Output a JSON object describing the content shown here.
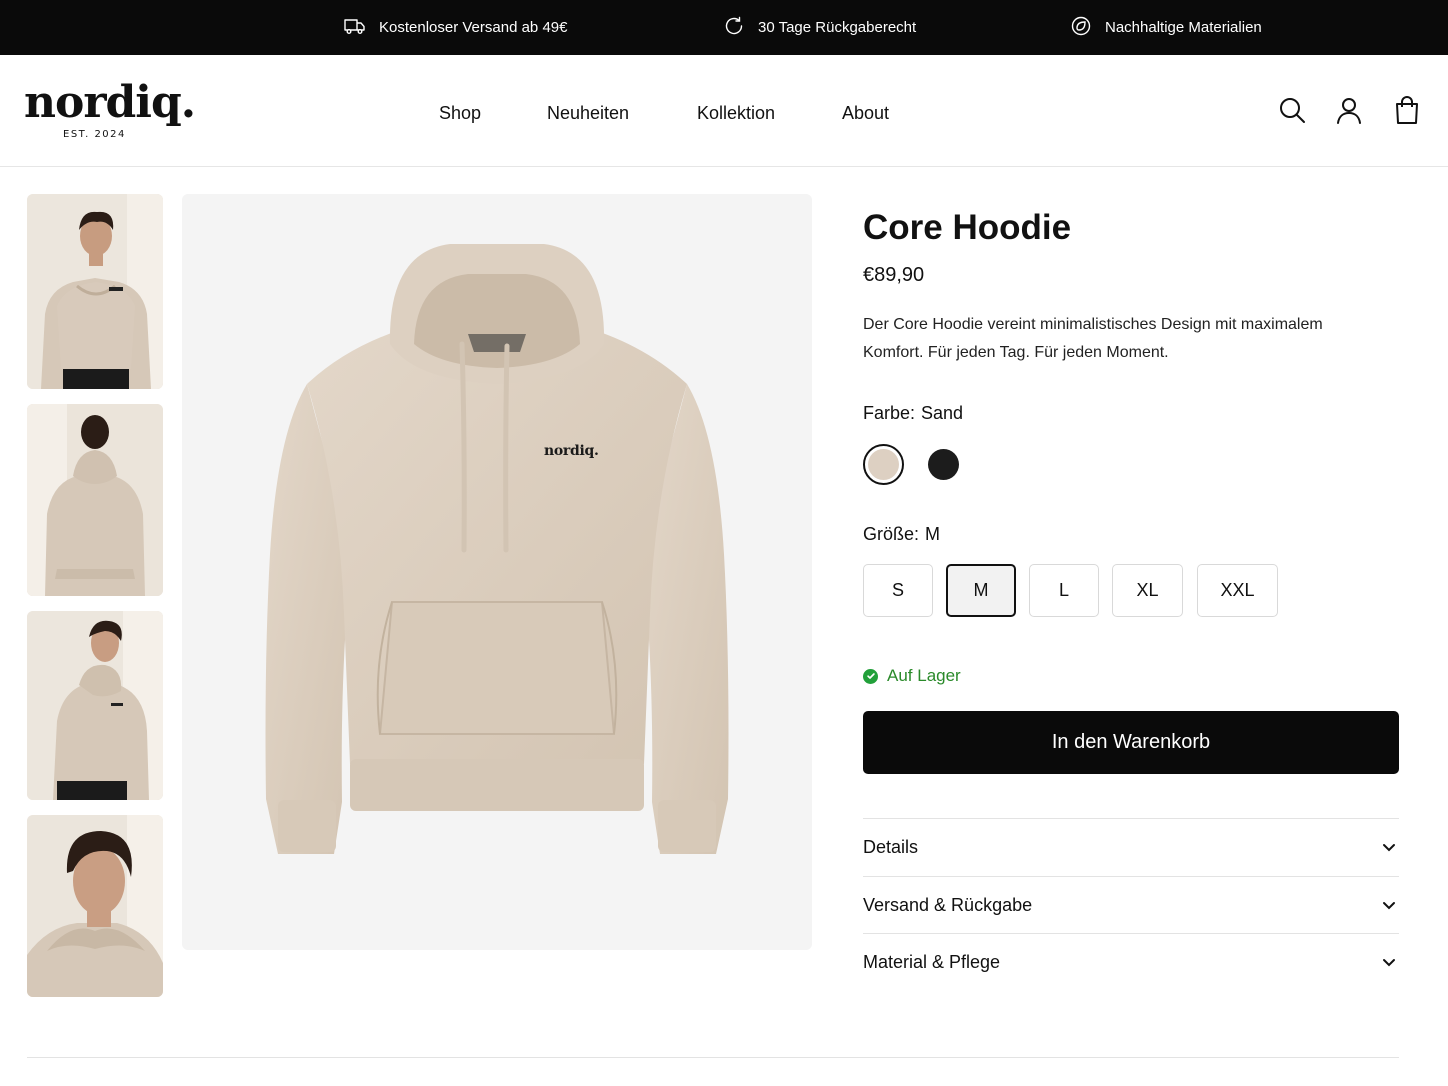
{
  "announcement": {
    "items": [
      {
        "icon": "truck-icon",
        "text": "Kostenloser Versand ab 49€"
      },
      {
        "icon": "return-icon",
        "text": "30 Tage Rückgaberecht"
      },
      {
        "icon": "leaf-badge-icon",
        "text": "Nachhaltige Materialien"
      }
    ]
  },
  "brand": {
    "name": "nordiq.",
    "tagline": "EST. 2024"
  },
  "nav": {
    "items": [
      "Shop",
      "Neuheiten",
      "Kollektion",
      "About"
    ]
  },
  "header_icons": [
    "search-icon",
    "account-icon",
    "shopping-bag-icon"
  ],
  "gallery": {
    "thumbnails": [
      "front-view",
      "back-view",
      "side-view",
      "portrait-view"
    ],
    "main_image": "sand-hoodie-front",
    "hoodie_print": "nordiq."
  },
  "product": {
    "title": "Core Hoodie",
    "price": "€89,90",
    "description": "Der Core Hoodie vereint minimalistisches Design mit maximalem Komfort. Für jeden Tag. Für jeden Moment.",
    "color_label": "Farbe:",
    "color_value": "Sand",
    "colors": [
      {
        "name": "Sand",
        "hex": "#ddd0c2",
        "selected": true
      },
      {
        "name": "Schwarz",
        "hex": "#1c1c1c",
        "selected": false
      }
    ],
    "size_label": "Größe:",
    "size_value": "M",
    "sizes": [
      {
        "label": "S",
        "selected": false
      },
      {
        "label": "M",
        "selected": true
      },
      {
        "label": "L",
        "selected": false
      },
      {
        "label": "XL",
        "selected": false
      },
      {
        "label": "XXL",
        "selected": false
      }
    ],
    "stock": "Auf Lager",
    "cta": "In den Warenkorb",
    "accordion": [
      "Details",
      "Versand & Rückgabe",
      "Material & Pflege"
    ]
  },
  "colors": {
    "accent": "#0a0a0a",
    "stock_green": "#22a03a",
    "hoodie_sand": "#dccebf"
  }
}
